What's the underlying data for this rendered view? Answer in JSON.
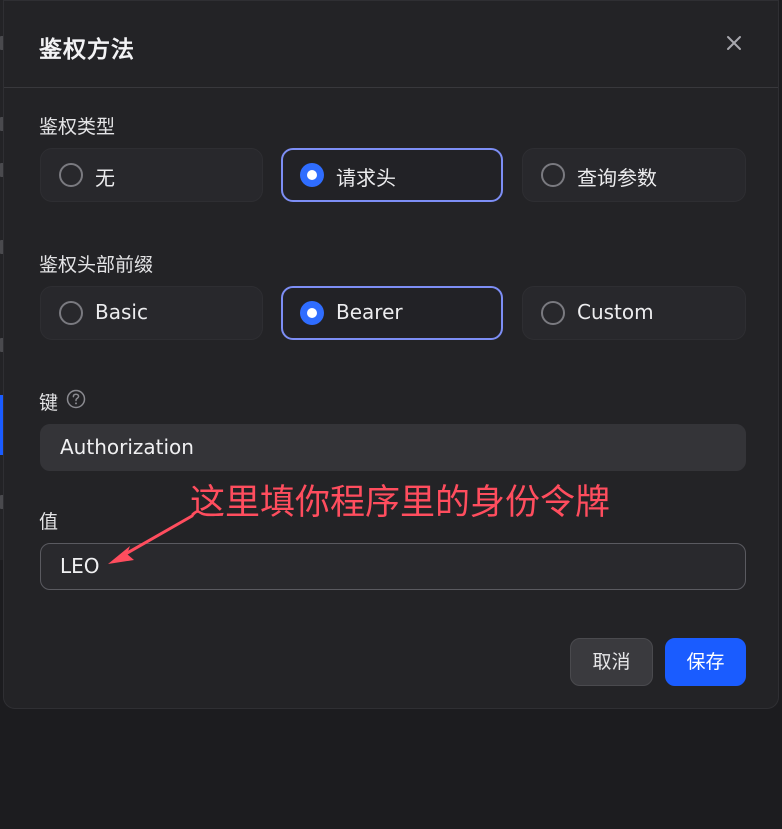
{
  "modal": {
    "title": "鉴权方法",
    "close_icon": "close-icon"
  },
  "auth_type": {
    "label": "鉴权类型",
    "options": [
      "无",
      "请求头",
      "查询参数"
    ],
    "selected": "请求头"
  },
  "header_prefix": {
    "label": "鉴权头部前缀",
    "options": [
      "Basic",
      "Bearer",
      "Custom"
    ],
    "selected": "Bearer"
  },
  "key_field": {
    "label": "键",
    "help_icon": "question-circle-icon",
    "value": "Authorization"
  },
  "value_field": {
    "label": "值",
    "value": "LEO"
  },
  "footer": {
    "cancel_label": "取消",
    "save_label": "保存"
  },
  "annotation": {
    "text": "这里填你程序里的身份令牌"
  },
  "colors": {
    "accent": "#1a5cff",
    "selected_border": "#7d8ef5",
    "annotation": "#ff4d5e"
  }
}
